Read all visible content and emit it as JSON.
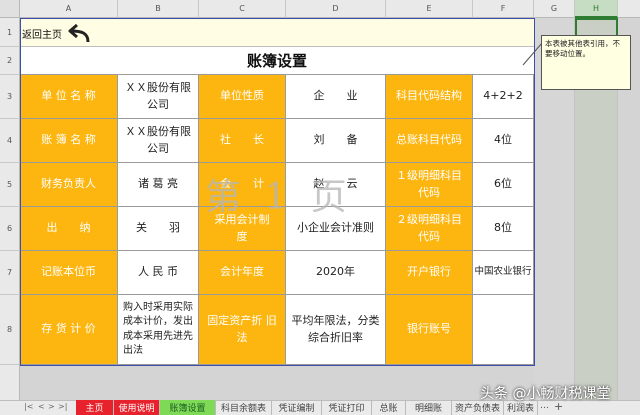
{
  "columns": [
    "A",
    "B",
    "C",
    "D",
    "E",
    "F",
    "G",
    "H"
  ],
  "rows": [
    "1",
    "2",
    "3",
    "4",
    "5",
    "6",
    "7",
    "8"
  ],
  "back_link": "返回主页",
  "title": "账簿设置",
  "comment": "本表被其他表引用，不要移动位置。",
  "watermark": "第 1 页",
  "table": [
    [
      "单 位 名 称",
      "ＸＸ股份有限公司",
      "单位性质",
      "企　　业",
      "科目代码结构",
      "4+2+2"
    ],
    [
      "账 簿 名 称",
      "ＸＸ股份有限公司",
      "社　　长",
      "刘　　备",
      "总账科目代码",
      "4位"
    ],
    [
      "财务负责人",
      "诸 葛 亮",
      "会　　计",
      "赵　　云",
      "１级明细科目代码",
      "6位"
    ],
    [
      "出　　纳",
      "关　　羽",
      "采用会计制　　度",
      "小企业会计准则",
      "２级明细科目代码",
      "8位"
    ],
    [
      "记账本位币",
      "人 民 币",
      "会计年度",
      "2020年",
      "开户银行",
      "中国农业银行"
    ],
    [
      "存 货 计 价",
      "购入时采用实际成本计价，发出成本采用先进先出法",
      "固定资产折 旧 法",
      "平均年限法，分类综合折旧率",
      "银行账号",
      ""
    ]
  ],
  "sheet_nav": [
    "|<",
    "<",
    ">",
    ">|"
  ],
  "sheet_tabs": [
    "主页",
    "使用说明",
    "账簿设置",
    "科目余额表",
    "凭证编制",
    "凭证打印",
    "总账",
    "明细账",
    "资产负债表",
    "利润表"
  ],
  "tab_more": "…",
  "tab_add": "+",
  "brand_watermark": "头条 @小畅财税课堂",
  "colors": {
    "gold": "#fdb60f",
    "active_tab": "#7ed957",
    "red_tab": "#e8222c",
    "selected_col": "#c6ddc3",
    "comment_bg": "#ffffe1",
    "title_bg": "#fffde3"
  }
}
